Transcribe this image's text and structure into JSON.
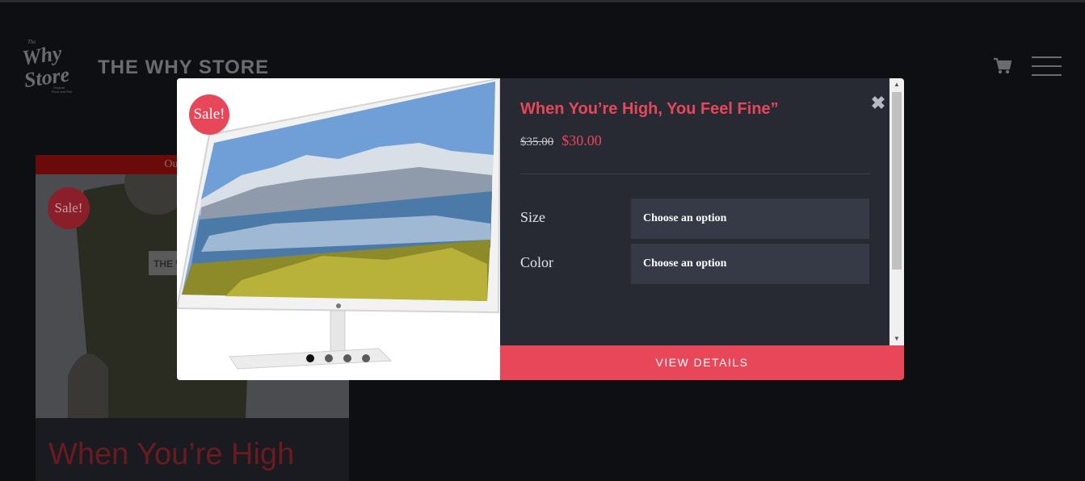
{
  "header": {
    "logo_text": "The Why Store",
    "site_title": "THE WHY STORE"
  },
  "background_card": {
    "banner": "Out of stock",
    "sale_badge": "Sale!",
    "title": "When You’re High"
  },
  "modal": {
    "sale_badge": "Sale!",
    "title": "When You’re High, You Feel Fine”",
    "price_old": "$35.00",
    "price_new": "$30.00",
    "attributes": [
      {
        "label": "Size",
        "placeholder": "Choose an option"
      },
      {
        "label": "Color",
        "placeholder": "Choose an option"
      }
    ],
    "view_details": "VIEW DETAILS",
    "gallery": {
      "slides": 4,
      "active": 1
    }
  },
  "colors": {
    "accent": "#e8475a",
    "modal_bg": "#272a33",
    "select_bg": "#363a47",
    "page_bg": "#0e0f13"
  },
  "icons": [
    "cart-icon",
    "menu-icon",
    "close-icon",
    "scroll-up-icon",
    "scroll-down-icon"
  ]
}
